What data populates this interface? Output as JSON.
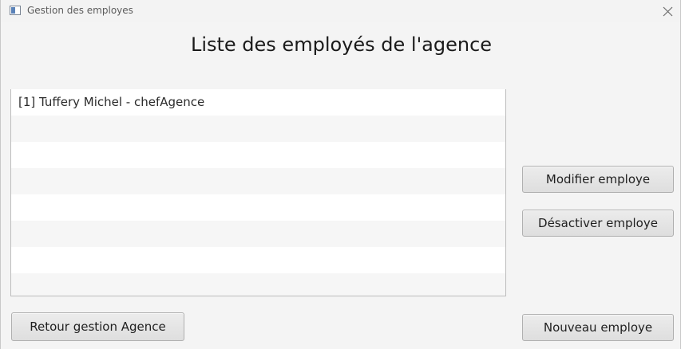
{
  "window": {
    "title": "Gestion des employes",
    "close_icon": "close-icon"
  },
  "main": {
    "heading": "Liste des employés de l'agence"
  },
  "employee_list": {
    "items": [
      "[1] Tuffery Michel - chefAgence",
      "",
      "",
      "",
      "",
      "",
      "",
      ""
    ]
  },
  "buttons": {
    "modifier": "Modifier employe",
    "desactiver": "Désactiver employe",
    "nouveau": "Nouveau employe",
    "retour": "Retour gestion Agence"
  },
  "colors": {
    "background": "#f4f4f4",
    "list_odd": "#ffffff",
    "list_even": "#f6f6f6",
    "button": "#e4e4e4"
  }
}
